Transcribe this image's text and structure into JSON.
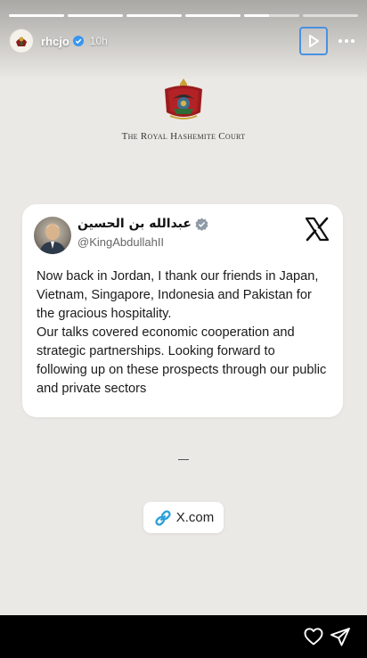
{
  "story": {
    "progress": [
      1,
      1,
      1,
      1,
      0.45,
      0
    ],
    "username": "rhcjo",
    "time": "10h"
  },
  "court": {
    "title": "The Royal Hashemite Court"
  },
  "tweet": {
    "display_name": "عبدالله بن الحسين",
    "handle": "@KingAbdullahII",
    "paragraphs": [
      "Now back in Jordan, I thank our friends in Japan, Vietnam, Singapore, Indonesia and Pakistan for the gracious hospitality.",
      "Our talks covered economic cooperation and strategic partnerships. Looking forward to following up on these prospects through our public and private sectors"
    ]
  },
  "link_sticker": {
    "label": "X.com"
  },
  "colors": {
    "story_bg": "#ebe9e5",
    "verified_blue": "#1d9bf0",
    "ig_verified": "#3897f0",
    "focus_outline": "#4a90e2"
  },
  "icons": {
    "avatar": "crest-avatar",
    "verified": "verified-badge-icon",
    "play": "play-icon",
    "more": "more-icon",
    "x_logo": "x-logo-icon",
    "link": "link-icon",
    "like": "heart-icon",
    "share": "send-icon"
  }
}
